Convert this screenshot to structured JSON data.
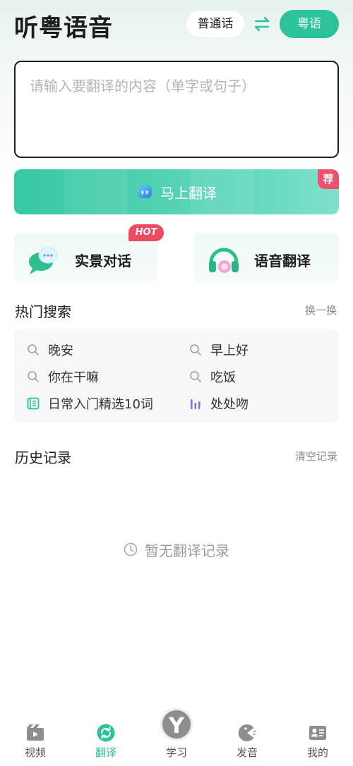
{
  "header": {
    "app_title": "听粤语音",
    "source_lang": "普通话",
    "target_lang": "粤语"
  },
  "input": {
    "placeholder": "请输入要翻译的内容（单字或句子）",
    "value": ""
  },
  "translate_button": {
    "label": "马上翻译",
    "badge": "荐"
  },
  "features": {
    "scene_dialog": {
      "label": "实景对话",
      "badge": "HOT"
    },
    "voice_translate": {
      "label": "语音翻译"
    }
  },
  "hot_search": {
    "title": "热门搜索",
    "refresh": "换一换",
    "items": [
      {
        "text": "晚安",
        "icon": "search-icon"
      },
      {
        "text": "早上好",
        "icon": "search-icon"
      },
      {
        "text": "你在干嘛",
        "icon": "search-icon"
      },
      {
        "text": "吃饭",
        "icon": "search-icon"
      },
      {
        "text": "日常入门精选10词",
        "icon": "book-list-icon"
      },
      {
        "text": "处处吻",
        "icon": "audio-bars-icon"
      }
    ]
  },
  "history": {
    "title": "历史记录",
    "clear": "清空记录",
    "empty": "暂无翻译记录"
  },
  "nav": {
    "items": [
      {
        "label": "视频",
        "icon": "video-icon",
        "active": false
      },
      {
        "label": "翻译",
        "icon": "translate-icon",
        "active": true
      },
      {
        "label": "学习",
        "icon": "learn-icon",
        "active": false
      },
      {
        "label": "发音",
        "icon": "pronounce-icon",
        "active": false
      },
      {
        "label": "我的",
        "icon": "profile-icon",
        "active": false
      }
    ]
  },
  "colors": {
    "accent": "#2cc39b",
    "badge_red": "#ee4a60",
    "purple": "#8b6ee0"
  }
}
